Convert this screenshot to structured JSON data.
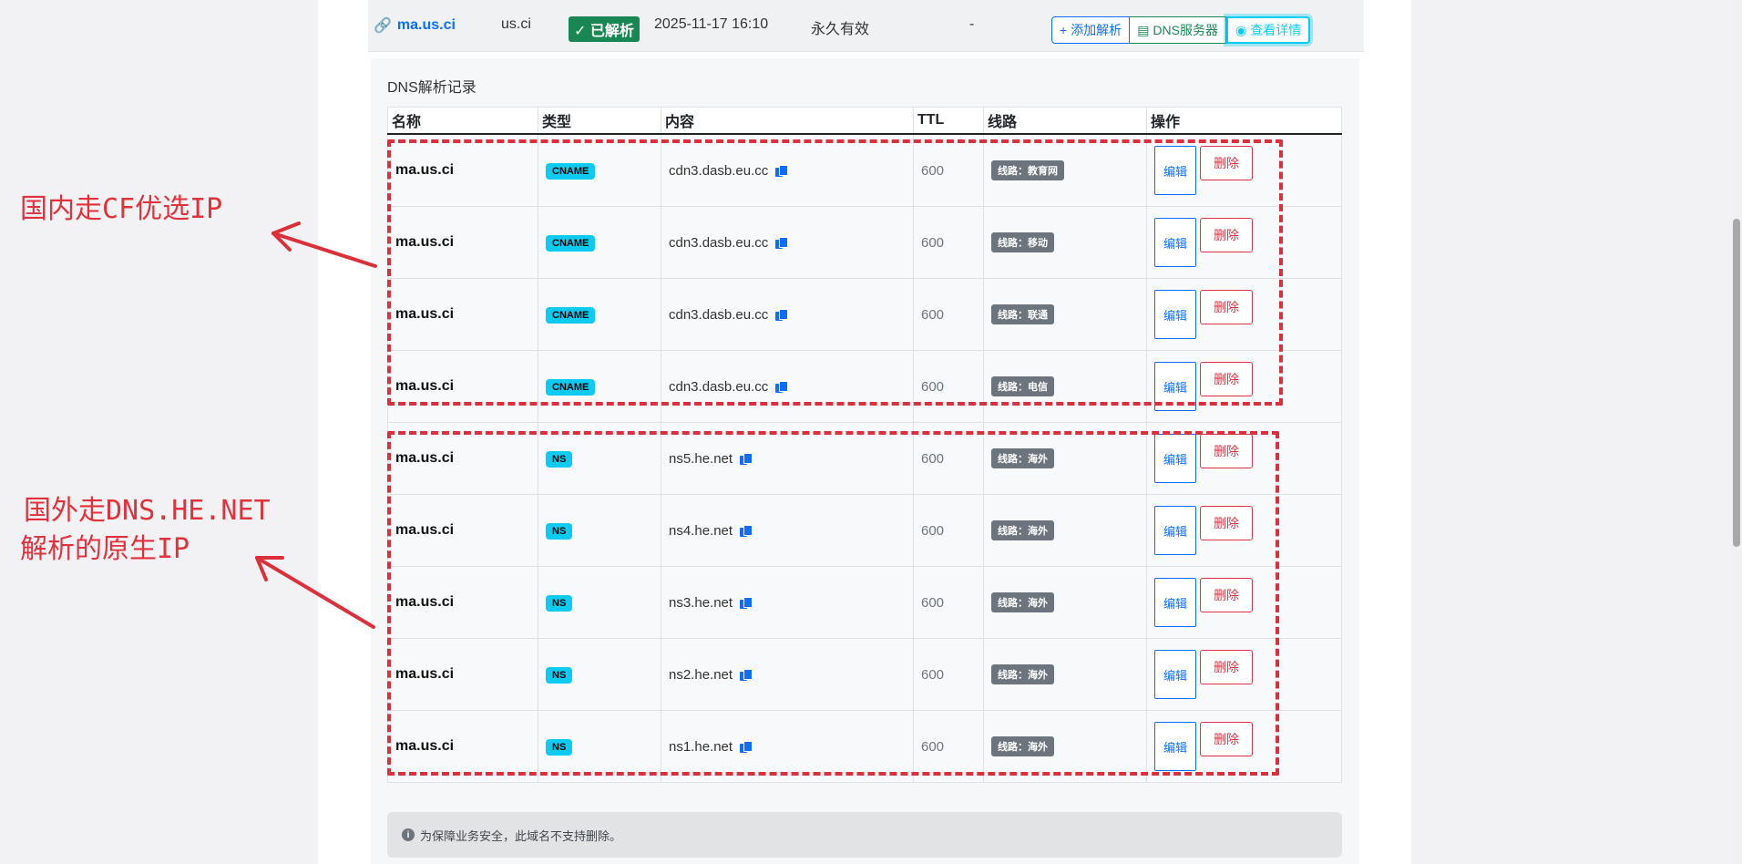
{
  "domain": {
    "name": "ma.us.ci",
    "suffix": "us.ci",
    "status": "已解析",
    "time": "2025-11-17 16:10",
    "expiry": "永久有效",
    "dash": "-",
    "actions": {
      "add": "添加解析",
      "dns": "DNS服务器",
      "view": "查看详情"
    }
  },
  "panel_title": "DNS解析记录",
  "table": {
    "headers": [
      "名称",
      "类型",
      "内容",
      "TTL",
      "线路",
      "操作"
    ],
    "edit_label": "编辑",
    "delete_label": "删除",
    "rows": [
      {
        "name": "ma.us.ci",
        "type": "CNAME",
        "content": "cdn3.dasb.eu.cc",
        "ttl": "600",
        "line": "线路：教育网"
      },
      {
        "name": "ma.us.ci",
        "type": "CNAME",
        "content": "cdn3.dasb.eu.cc",
        "ttl": "600",
        "line": "线路：移动"
      },
      {
        "name": "ma.us.ci",
        "type": "CNAME",
        "content": "cdn3.dasb.eu.cc",
        "ttl": "600",
        "line": "线路：联通"
      },
      {
        "name": "ma.us.ci",
        "type": "CNAME",
        "content": "cdn3.dasb.eu.cc",
        "ttl": "600",
        "line": "线路：电信"
      },
      {
        "name": "ma.us.ci",
        "type": "NS",
        "content": "ns5.he.net",
        "ttl": "600",
        "line": "线路：海外"
      },
      {
        "name": "ma.us.ci",
        "type": "NS",
        "content": "ns4.he.net",
        "ttl": "600",
        "line": "线路：海外"
      },
      {
        "name": "ma.us.ci",
        "type": "NS",
        "content": "ns3.he.net",
        "ttl": "600",
        "line": "线路：海外"
      },
      {
        "name": "ma.us.ci",
        "type": "NS",
        "content": "ns2.he.net",
        "ttl": "600",
        "line": "线路：海外"
      },
      {
        "name": "ma.us.ci",
        "type": "NS",
        "content": "ns1.he.net",
        "ttl": "600",
        "line": "线路：海外"
      }
    ]
  },
  "annotations": {
    "top": "国内走CF优选IP",
    "bottom_line1": "国外走DNS.HE.NET",
    "bottom_line2": "解析的原生IP"
  },
  "notice": "为保障业务安全，此域名不支持删除。",
  "colors": {
    "annotation": "#dc2f3c",
    "primary": "#0d6efd",
    "info": "#0dcaf0"
  }
}
